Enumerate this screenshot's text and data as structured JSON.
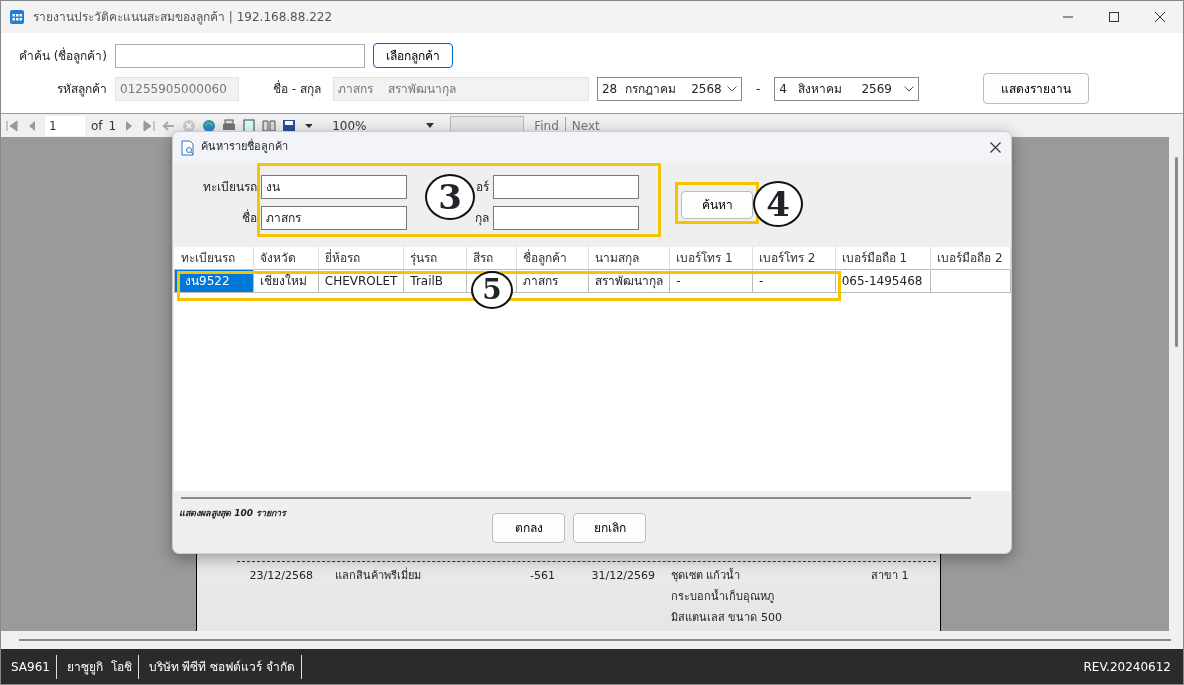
{
  "window": {
    "title": "รายงานประวัติคะแนนสะสมของลูกค้า | 192.168.88.222"
  },
  "filter": {
    "search_label": "คำค้น (ชื่อลูกค้า)",
    "select_button": "เลือกลูกค้า",
    "code_label": "รหัสลูกค้า",
    "code_value": "01255905000060",
    "name_label": "ชื่อ - สกุล",
    "name_value": "ภาสกร    สราพัฒนากุล",
    "date_from": "28  กรกฎาคม    2568",
    "date_sep": "-",
    "date_to": "4   สิงหาคม     2569",
    "report_button": "แสดงรายงาน"
  },
  "toolbar": {
    "page": "1",
    "of": "of",
    "total": "1",
    "zoom": "100%",
    "find": "Find",
    "next": "Next"
  },
  "report_rows": [
    {
      "date": "23/12/2568",
      "type": "แลกสินค้าพรีเมี่ยม",
      "points": "-561",
      "expiry": "31/12/2569",
      "items": [
        "ชุดเซต แก้วน้ำ",
        "กระบอกน้ำเก็บอุณหภู",
        "มิสแตนเลส ขนาด 500"
      ],
      "branch": "สาขา 1"
    }
  ],
  "dialog": {
    "title": "ค้นหารายชื่อลูกค้า",
    "fields": [
      {
        "label": "ทะเบียนรถ",
        "value": "งน"
      },
      {
        "label": "อร์"
      },
      {
        "label": "ชื่อ",
        "value": "ภาสกร"
      },
      {
        "label": "กุล"
      }
    ],
    "search_button": "ค้นหา",
    "columns": [
      "ทะเบียนรถ",
      "จังหวัด",
      "ยี่ห้อรถ",
      "รุ่นรถ",
      "สีรถ",
      "ชื่อลูกค้า",
      "นามสกุล",
      "เบอร์โทร 1",
      "เบอร์โทร 2",
      "เบอร์มือถือ 1",
      "เบอร์มือถือ 2"
    ],
    "rows": [
      {
        "selected": true,
        "cells": [
          "งน9522",
          "เชียงใหม่",
          "CHEVROLET",
          "TrailB",
          null,
          "ภาสกร",
          "สราพัฒนากุล",
          "-",
          "-",
          "065-1495468",
          null
        ]
      }
    ],
    "footer": "แสดงผลสูงสุด 100 รายการ",
    "ok_button": "ตกลง",
    "cancel_button": "ยกเลิก"
  },
  "annotations": [
    {
      "number": "3"
    },
    {
      "number": "4"
    },
    {
      "number": "5"
    }
  ],
  "status_bar": {
    "items": [
      "SA961",
      "ยาซูยูกิ  โอชิ",
      "บริษัท พีซีที ซอฟต์แวร์ จำกัด"
    ],
    "version": "REV.20240612"
  }
}
